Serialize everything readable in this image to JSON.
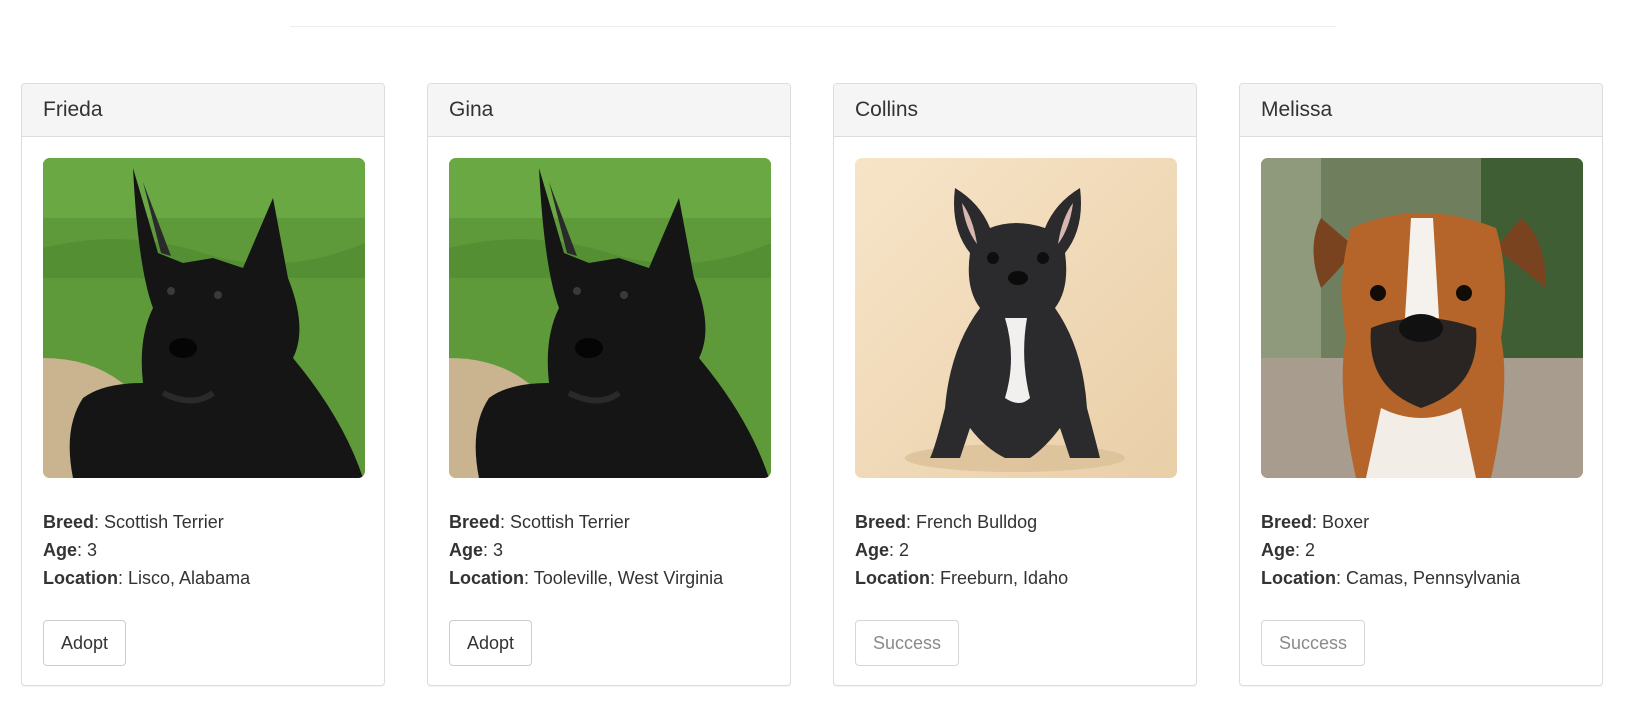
{
  "labels": {
    "breed": "Breed",
    "age": "Age",
    "location": "Location"
  },
  "pets": [
    {
      "name": "Frieda",
      "breed": "Scottish Terrier",
      "age": "3",
      "location": "Lisco, Alabama",
      "button_label": "Adopt",
      "button_enabled": true,
      "photo": "scottish-terrier-photo"
    },
    {
      "name": "Gina",
      "breed": "Scottish Terrier",
      "age": "3",
      "location": "Tooleville, West Virginia",
      "button_label": "Adopt",
      "button_enabled": true,
      "photo": "scottish-terrier-photo"
    },
    {
      "name": "Collins",
      "breed": "French Bulldog",
      "age": "2",
      "location": "Freeburn, Idaho",
      "button_label": "Success",
      "button_enabled": false,
      "photo": "french-bulldog-photo"
    },
    {
      "name": "Melissa",
      "breed": "Boxer",
      "age": "2",
      "location": "Camas, Pennsylvania",
      "button_label": "Success",
      "button_enabled": false,
      "photo": "boxer-photo"
    }
  ],
  "colors": {
    "panel_heading_bg": "#f5f5f5",
    "panel_border": "#dddddd",
    "text": "#333333",
    "disabled_text": "#8a8a8a"
  }
}
